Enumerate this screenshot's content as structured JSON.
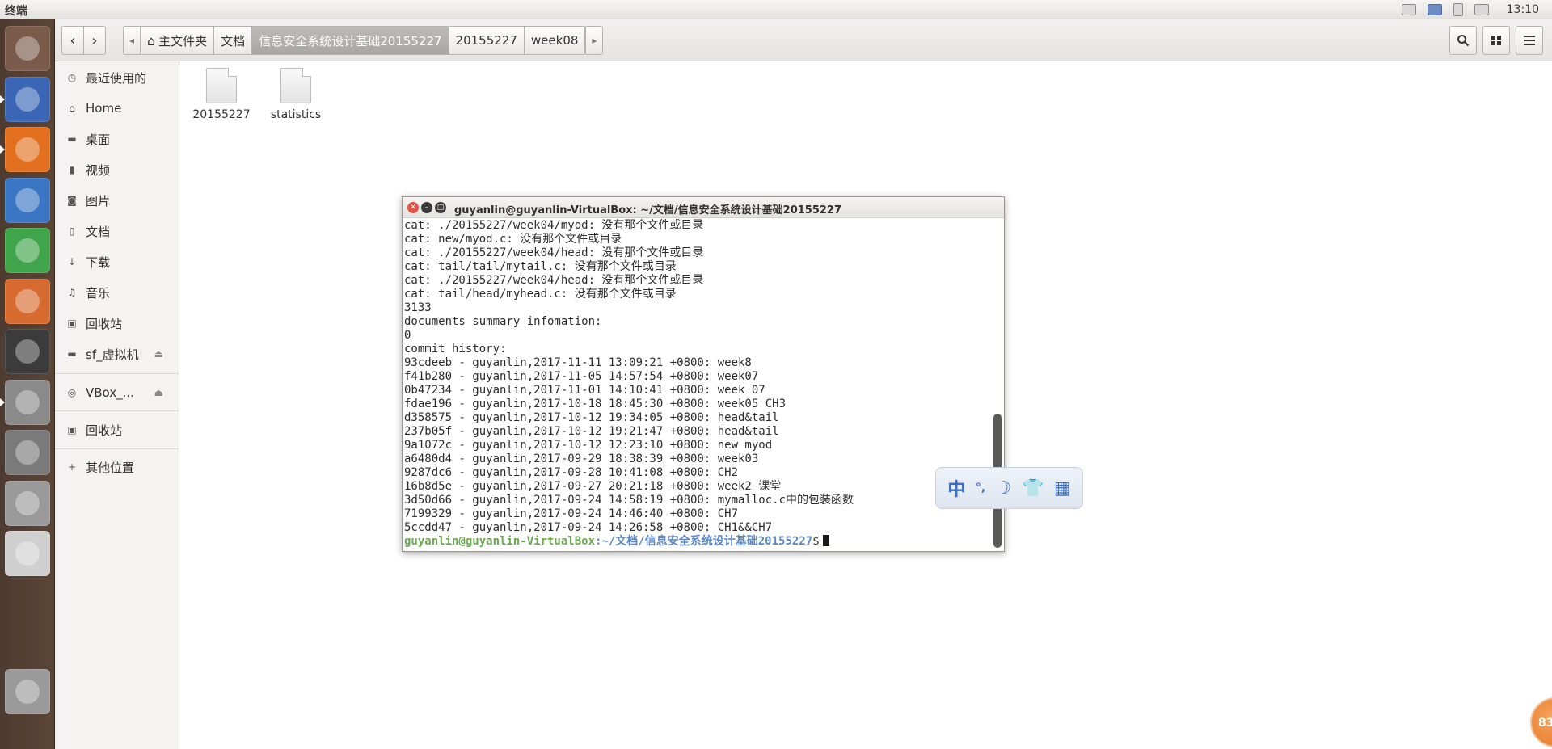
{
  "top_panel": {
    "app_title": "终端",
    "clock": "13:10",
    "indicators": [
      "keyboard-icon",
      "network-icon",
      "battery-icon",
      "display-icon"
    ]
  },
  "launcher": {
    "items": [
      {
        "name": "ubuntu-dash-icon",
        "color": "#7a5a4a"
      },
      {
        "name": "files-icon",
        "color": "#3a66b5"
      },
      {
        "name": "firefox-icon",
        "color": "#e2701f"
      },
      {
        "name": "libreoffice-impress-icon",
        "color": "#3a76c4"
      },
      {
        "name": "libreoffice-calc-icon",
        "color": "#3fa44a"
      },
      {
        "name": "libreoffice-presentation-icon",
        "color": "#d76b2f"
      },
      {
        "name": "amazon-icon",
        "color": "#3b3b3b"
      },
      {
        "name": "system-settings-icon",
        "color": "#8a8a8a"
      },
      {
        "name": "help-icon",
        "color": "#7a7a7a"
      },
      {
        "name": "text-editor-icon",
        "color": "#9a9a9a"
      },
      {
        "name": "dvd-icon",
        "color": "#cfcfcf"
      },
      {
        "name": "trash-icon",
        "color": "#9a9a9a"
      }
    ]
  },
  "header": {
    "back_symbol": "‹",
    "forward_symbol": "›",
    "scroll_left_symbol": "◂",
    "scroll_right_symbol": "▸",
    "path": [
      "主文件夹",
      "文档",
      "信息安全系统设计基础20155227",
      "20155227",
      "week08"
    ],
    "active_index": 2
  },
  "sidebar": {
    "items": [
      {
        "label": "最近使用的",
        "icon": "clock-icon",
        "glyph": "◷"
      },
      {
        "label": "Home",
        "icon": "home-icon",
        "glyph": "⌂"
      },
      {
        "label": "桌面",
        "icon": "desktop-folder-icon",
        "glyph": "▬"
      },
      {
        "label": "视频",
        "icon": "video-icon",
        "glyph": "▮"
      },
      {
        "label": "图片",
        "icon": "camera-icon",
        "glyph": "◙"
      },
      {
        "label": "文档",
        "icon": "document-icon",
        "glyph": "▯"
      },
      {
        "label": "下载",
        "icon": "download-icon",
        "glyph": "↓"
      },
      {
        "label": "音乐",
        "icon": "music-icon",
        "glyph": "♫"
      },
      {
        "label": "回收站",
        "icon": "trash-icon",
        "glyph": "▣"
      },
      {
        "label": "sf_虚拟机",
        "icon": "drive-icon",
        "glyph": "▬",
        "eject": true
      }
    ],
    "devices": [
      {
        "label": "VBox_...",
        "icon": "disc-icon",
        "glyph": "◎",
        "eject": true
      }
    ],
    "extras": [
      {
        "label": "回收站",
        "icon": "trash-icon",
        "glyph": "▣"
      },
      {
        "label": "其他位置",
        "icon": "plus-icon",
        "glyph": "+"
      }
    ]
  },
  "files": [
    {
      "name": "20155227"
    },
    {
      "name": "statistics"
    }
  ],
  "terminal": {
    "title": "guyanlin@guyanlin-VirtualBox: ~/文档/信息安全系统设计基础20155227",
    "lines": [
      "cat: ./20155227/week04/myod: 没有那个文件或目录",
      "cat: new/myod.c: 没有那个文件或目录",
      "cat: ./20155227/week04/head: 没有那个文件或目录",
      "cat: tail/tail/mytail.c: 没有那个文件或目录",
      "cat: ./20155227/week04/head: 没有那个文件或目录",
      "cat: tail/head/myhead.c: 没有那个文件或目录",
      "3133",
      "documents summary infomation:",
      "0",
      "commit history:",
      "93cdeeb - guyanlin,2017-11-11 13:09:21 +0800: week8",
      "f41b280 - guyanlin,2017-11-05 14:57:54 +0800: week07",
      "0b47234 - guyanlin,2017-11-01 14:10:41 +0800: week 07",
      "fdae196 - guyanlin,2017-10-18 18:45:30 +0800: week05 CH3",
      "d358575 - guyanlin,2017-10-12 19:34:05 +0800: head&tail",
      "237b05f - guyanlin,2017-10-12 19:21:47 +0800: head&tail",
      "9a1072c - guyanlin,2017-10-12 12:23:10 +0800: new myod",
      "a6480d4 - guyanlin,2017-09-29 18:38:39 +0800: week03",
      "9287dc6 - guyanlin,2017-09-28 10:41:08 +0800: CH2",
      "16b8d5e - guyanlin,2017-09-27 20:21:18 +0800: week2 课堂",
      "3d50d66 - guyanlin,2017-09-24 14:58:19 +0800: mymalloc.c中的包装函数",
      "7199329 - guyanlin,2017-09-24 14:46:40 +0800: CH7",
      "5ccdd47 - guyanlin,2017-09-24 14:26:58 +0800: CH1&&CH7"
    ],
    "prompt_user": "guyanlin@guyanlin-VirtualBox",
    "prompt_path": ":~/文档/信息安全系统设计基础20155227",
    "prompt_symbol": "$"
  },
  "ime": {
    "items": [
      "中",
      "°,",
      "☽",
      "👕",
      "▦"
    ]
  },
  "orb": {
    "text": "83"
  }
}
